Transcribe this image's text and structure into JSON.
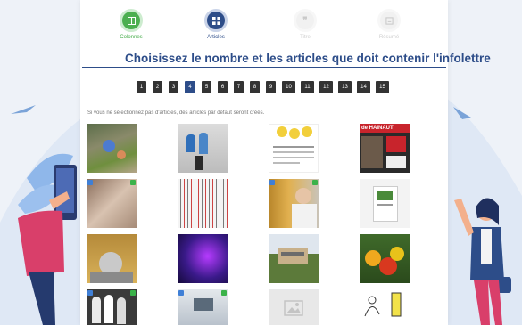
{
  "stepper": {
    "steps": [
      {
        "label": "Colonnes",
        "state": "done",
        "icon": "columns-icon"
      },
      {
        "label": "Articles",
        "state": "active",
        "icon": "grid-icon"
      },
      {
        "label": "Titre",
        "state": "pending",
        "icon": "quote-icon"
      },
      {
        "label": "Résumé",
        "state": "pending",
        "icon": "summary-icon"
      }
    ]
  },
  "page_title": "Choisissez le nombre et les articles que doit contenir l'infolettre",
  "pagination": {
    "pages": [
      "1",
      "2",
      "3",
      "4",
      "5",
      "6",
      "7",
      "8",
      "9",
      "10",
      "11",
      "12",
      "13",
      "14",
      "15"
    ],
    "selected": "4"
  },
  "helper_text": "Si vous ne sélectionnez pas d'articles, des articles par défaut seront créés.",
  "article_images": [
    {
      "name": "garden-photo"
    },
    {
      "name": "kids-wall-photo"
    },
    {
      "name": "smiley-doc-photo"
    },
    {
      "name": "newspaper-photo",
      "text": "de HAINAUT"
    },
    {
      "name": "hands-photo"
    },
    {
      "name": "pattern-photo"
    },
    {
      "name": "library-photo"
    },
    {
      "name": "booklet-photo"
    },
    {
      "name": "kettle-photo"
    },
    {
      "name": "purple-light-photo"
    },
    {
      "name": "building-photo"
    },
    {
      "name": "vegetables-photo"
    },
    {
      "name": "figures-photo"
    },
    {
      "name": "desk-photo"
    },
    {
      "name": "placeholder-image"
    },
    {
      "name": "sketch-photo"
    }
  ],
  "colors": {
    "accent": "#2d4d89",
    "done": "#4caf50",
    "pager": "#333333"
  }
}
